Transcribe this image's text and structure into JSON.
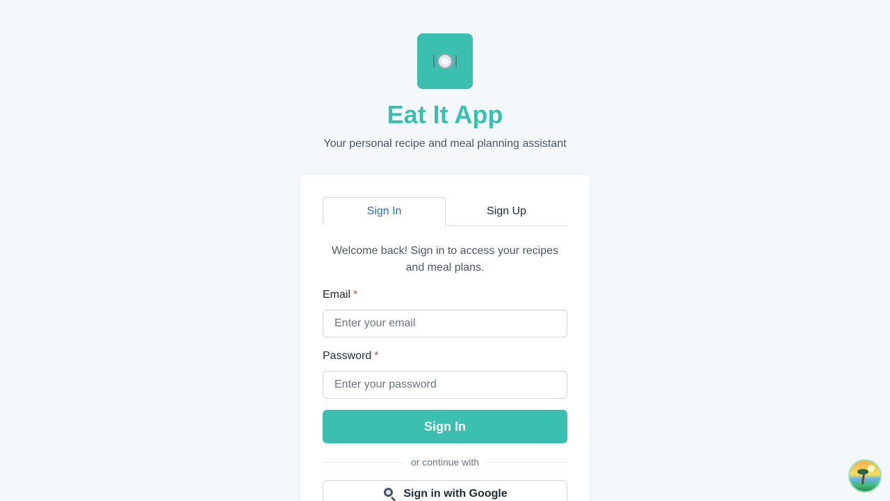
{
  "app": {
    "title": "Eat It App",
    "subtitle": "Your personal recipe and meal planning assistant",
    "logo_icon": "plate-cutlery-icon"
  },
  "auth": {
    "tabs": [
      {
        "label": "Sign In",
        "active": true
      },
      {
        "label": "Sign Up",
        "active": false
      }
    ],
    "welcome": "Welcome back! Sign in to access your recipes and meal plans.",
    "email": {
      "label": "Email",
      "required_mark": "*",
      "placeholder": "Enter your email",
      "value": ""
    },
    "password": {
      "label": "Password",
      "required_mark": "*",
      "placeholder": "Enter your password",
      "value": ""
    },
    "submit_label": "Sign In",
    "divider_text": "or continue with",
    "google_label": "Sign in with Google",
    "google_icon": "magnifying-glass-icon"
  },
  "user": {
    "avatar_icon": "island-avatar"
  },
  "colors": {
    "brand": "#3bbfb0",
    "active_tab": "#2b6cb0",
    "required": "#e53e3e",
    "background": "#f4f8fb"
  }
}
